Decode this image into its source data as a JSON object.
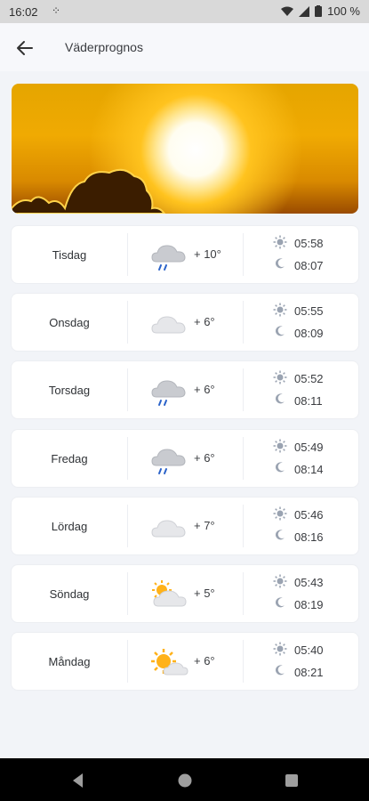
{
  "status_bar": {
    "time": "16:02",
    "battery": "100 %"
  },
  "app_bar": {
    "title": "Väderprognos"
  },
  "forecast": [
    {
      "day": "Tisdag",
      "icon": "rain-cloud-icon",
      "temp": "+ 10°",
      "sunrise": "05:58",
      "sunset": "08:07"
    },
    {
      "day": "Onsdag",
      "icon": "cloud-icon",
      "temp": "+ 6°",
      "sunrise": "05:55",
      "sunset": "08:09"
    },
    {
      "day": "Torsdag",
      "icon": "rain-cloud-icon",
      "temp": "+ 6°",
      "sunrise": "05:52",
      "sunset": "08:11"
    },
    {
      "day": "Fredag",
      "icon": "rain-cloud-icon",
      "temp": "+ 6°",
      "sunrise": "05:49",
      "sunset": "08:14"
    },
    {
      "day": "Lördag",
      "icon": "cloud-icon",
      "temp": "+ 7°",
      "sunrise": "05:46",
      "sunset": "08:16"
    },
    {
      "day": "Söndag",
      "icon": "partly-cloudy-icon",
      "temp": "+ 5°",
      "sunrise": "05:43",
      "sunset": "08:19"
    },
    {
      "day": "Måndag",
      "icon": "sun-behind-cloud-icon",
      "temp": "+ 6°",
      "sunrise": "05:40",
      "sunset": "08:21"
    }
  ],
  "colors": {
    "background": "#f2f4f8",
    "card": "#ffffff",
    "navbar": "#000000",
    "accent_sun": "#ffc31e"
  }
}
